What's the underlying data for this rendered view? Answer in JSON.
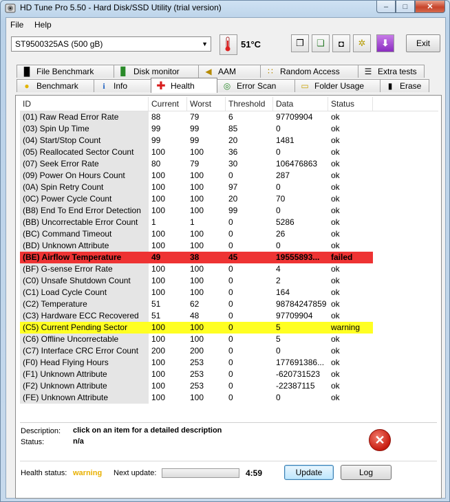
{
  "window": {
    "title": "HD Tune Pro 5.50 - Hard Disk/SSD Utility (trial version)",
    "controls": {
      "minimize": "–",
      "maximize": "□",
      "close": "✕"
    }
  },
  "menu": {
    "file": "File",
    "help": "Help"
  },
  "toolbar": {
    "drive": "ST9500325AS (500 gB)",
    "temperature": "51°C",
    "exit_label": "Exit",
    "icons": [
      "copy-text-icon",
      "copy-screen-icon",
      "screenshot-camera-icon",
      "options-gear-icon",
      "save-download-icon"
    ]
  },
  "tabs": {
    "row1": [
      {
        "label": "File Benchmark",
        "icon": "file-benchmark-icon",
        "glyph": "█"
      },
      {
        "label": "Disk monitor",
        "icon": "disk-monitor-icon",
        "glyph": "▊"
      },
      {
        "label": "AAM",
        "icon": "speaker-icon",
        "glyph": "◀"
      },
      {
        "label": "Random Access",
        "icon": "random-access-icon",
        "glyph": "∷"
      },
      {
        "label": "Extra tests",
        "icon": "extra-tests-icon",
        "glyph": "☰"
      }
    ],
    "row2": [
      {
        "label": "Benchmark",
        "icon": "benchmark-bulb-icon",
        "glyph": "●"
      },
      {
        "label": "Info",
        "icon": "info-icon",
        "glyph": "i"
      },
      {
        "label": "Health",
        "icon": "health-cross-icon",
        "glyph": "✚",
        "active": true
      },
      {
        "label": "Error Scan",
        "icon": "error-scan-icon",
        "glyph": "◎"
      },
      {
        "label": "Folder Usage",
        "icon": "folder-icon",
        "glyph": "▭"
      },
      {
        "label": "Erase",
        "icon": "erase-trash-icon",
        "glyph": "▮"
      }
    ]
  },
  "grid": {
    "headers": [
      "ID",
      "Current",
      "Worst",
      "Threshold",
      "Data",
      "Status"
    ],
    "rows": [
      {
        "id": "(01) Raw Read Error Rate",
        "current": "88",
        "worst": "79",
        "threshold": "6",
        "data": "97709904",
        "status": "ok"
      },
      {
        "id": "(03) Spin Up Time",
        "current": "99",
        "worst": "99",
        "threshold": "85",
        "data": "0",
        "status": "ok"
      },
      {
        "id": "(04) Start/Stop Count",
        "current": "99",
        "worst": "99",
        "threshold": "20",
        "data": "1481",
        "status": "ok"
      },
      {
        "id": "(05) Reallocated Sector Count",
        "current": "100",
        "worst": "100",
        "threshold": "36",
        "data": "0",
        "status": "ok"
      },
      {
        "id": "(07) Seek Error Rate",
        "current": "80",
        "worst": "79",
        "threshold": "30",
        "data": "106476863",
        "status": "ok"
      },
      {
        "id": "(09) Power On Hours Count",
        "current": "100",
        "worst": "100",
        "threshold": "0",
        "data": "287",
        "status": "ok"
      },
      {
        "id": "(0A) Spin Retry Count",
        "current": "100",
        "worst": "100",
        "threshold": "97",
        "data": "0",
        "status": "ok"
      },
      {
        "id": "(0C) Power Cycle Count",
        "current": "100",
        "worst": "100",
        "threshold": "20",
        "data": "70",
        "status": "ok"
      },
      {
        "id": "(B8) End To End Error Detection",
        "current": "100",
        "worst": "100",
        "threshold": "99",
        "data": "0",
        "status": "ok"
      },
      {
        "id": "(BB) Uncorrectable Error Count",
        "current": "1",
        "worst": "1",
        "threshold": "0",
        "data": "5286",
        "status": "ok"
      },
      {
        "id": "(BC) Command Timeout",
        "current": "100",
        "worst": "100",
        "threshold": "0",
        "data": "26",
        "status": "ok"
      },
      {
        "id": "(BD) Unknown Attribute",
        "current": "100",
        "worst": "100",
        "threshold": "0",
        "data": "0",
        "status": "ok"
      },
      {
        "id": "(BE) Airflow Temperature",
        "current": "49",
        "worst": "38",
        "threshold": "45",
        "data": "19555893...",
        "status": "failed",
        "state": "failed"
      },
      {
        "id": "(BF) G-sense Error Rate",
        "current": "100",
        "worst": "100",
        "threshold": "0",
        "data": "4",
        "status": "ok"
      },
      {
        "id": "(C0) Unsafe Shutdown Count",
        "current": "100",
        "worst": "100",
        "threshold": "0",
        "data": "2",
        "status": "ok"
      },
      {
        "id": "(C1) Load Cycle Count",
        "current": "100",
        "worst": "100",
        "threshold": "0",
        "data": "164",
        "status": "ok"
      },
      {
        "id": "(C2) Temperature",
        "current": "51",
        "worst": "62",
        "threshold": "0",
        "data": "98784247859",
        "status": "ok"
      },
      {
        "id": "(C3) Hardware ECC Recovered",
        "current": "51",
        "worst": "48",
        "threshold": "0",
        "data": "97709904",
        "status": "ok"
      },
      {
        "id": "(C5) Current Pending Sector",
        "current": "100",
        "worst": "100",
        "threshold": "0",
        "data": "5",
        "status": "warning",
        "state": "warning"
      },
      {
        "id": "(C6) Offline Uncorrectable",
        "current": "100",
        "worst": "100",
        "threshold": "0",
        "data": "5",
        "status": "ok"
      },
      {
        "id": "(C7) Interface CRC Error Count",
        "current": "200",
        "worst": "200",
        "threshold": "0",
        "data": "0",
        "status": "ok"
      },
      {
        "id": "(F0) Head Flying Hours",
        "current": "100",
        "worst": "253",
        "threshold": "0",
        "data": "177691386...",
        "status": "ok"
      },
      {
        "id": "(F1) Unknown Attribute",
        "current": "100",
        "worst": "253",
        "threshold": "0",
        "data": "-620731523",
        "status": "ok"
      },
      {
        "id": "(F2) Unknown Attribute",
        "current": "100",
        "worst": "253",
        "threshold": "0",
        "data": "-22387115",
        "status": "ok"
      },
      {
        "id": "(FE) Unknown Attribute",
        "current": "100",
        "worst": "100",
        "threshold": "0",
        "data": "0",
        "status": "ok"
      }
    ]
  },
  "details": {
    "description_label": "Description:",
    "description_value": "click on an item for a detailed description",
    "status_label": "Status:",
    "status_value": "n/a"
  },
  "footer": {
    "health_label": "Health status:",
    "health_value": "warning",
    "next_update_label": "Next update:",
    "countdown": "4:59",
    "progress_fraction": 0.0,
    "update_label": "Update",
    "log_label": "Log"
  },
  "colors": {
    "failed_row": "#ee3333",
    "warning_row": "#ffff22",
    "warning_text": "#e8b000",
    "error_icon": "#c81c10"
  }
}
